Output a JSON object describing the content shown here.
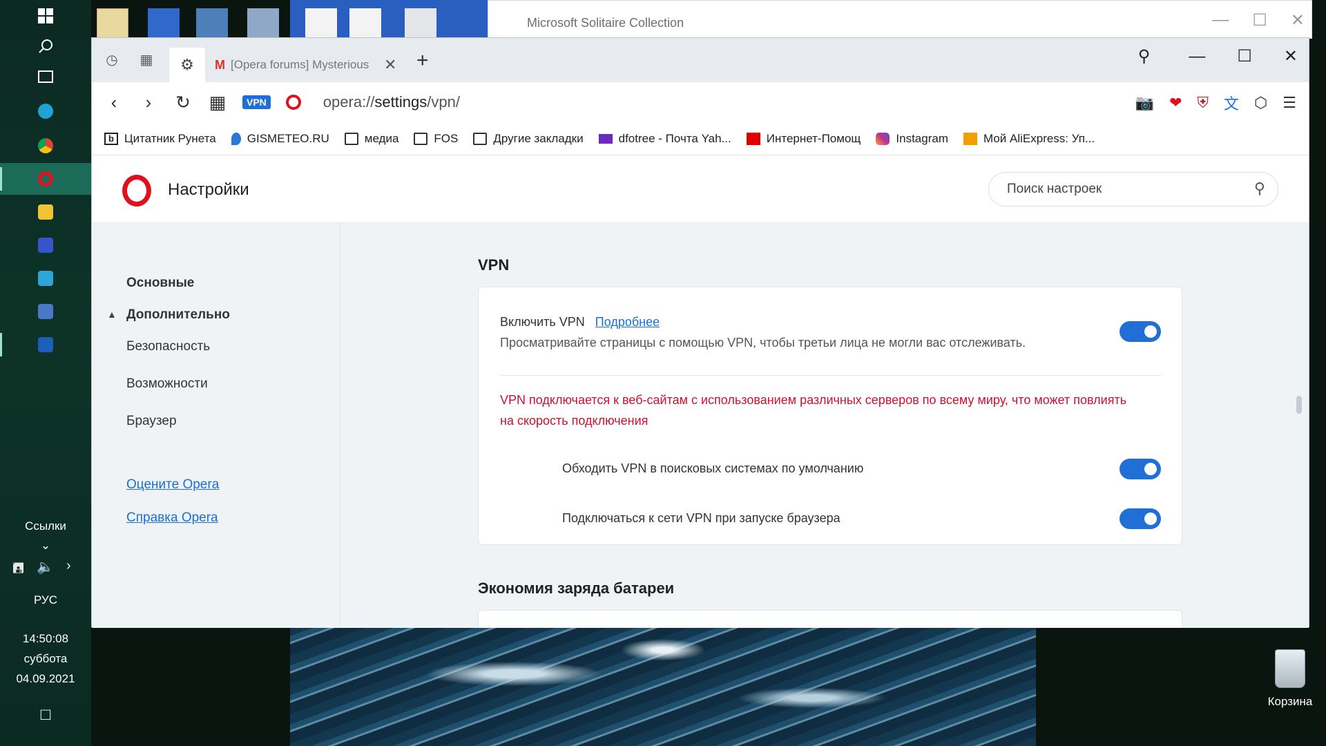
{
  "taskbar": {
    "links_label": "Ссылки",
    "links_chevron": "⌄",
    "language": "РУС",
    "time": "14:50:08",
    "weekday": "суббота",
    "date": "04.09.2021",
    "icons": [
      "windows-logo-icon",
      "search-icon",
      "task-view-icon",
      "edge-icon",
      "chrome-icon",
      "opera-icon",
      "file-explorer-icon",
      "save-icon",
      "store-icon",
      "remote-icon",
      "solitaire-icon"
    ]
  },
  "solitaire": {
    "title": "Microsoft Solitaire Collection"
  },
  "browser": {
    "tab_title": "[Opera forums] Mysterious",
    "url_scheme": "opera://",
    "url_host": "settings",
    "url_path": "/vpn/",
    "vpn_badge": "VPN",
    "bookmarks": [
      {
        "label": "Цитатник Рунета",
        "icon": "bookmark-b-icon",
        "color": "#222222"
      },
      {
        "label": "GISMETEO.RU",
        "icon": "gismeteo-icon",
        "color": "#2a7ad5"
      },
      {
        "label": "медиа",
        "icon": "folder-icon",
        "color": "#333333"
      },
      {
        "label": "FOS",
        "icon": "folder-icon",
        "color": "#333333"
      },
      {
        "label": "Другие закладки",
        "icon": "folder-icon",
        "color": "#333333"
      },
      {
        "label": "dfotree - Почта Yah...",
        "icon": "yahoo-mail-icon",
        "color": "#6b2bbd"
      },
      {
        "label": "Интернет-Помощ",
        "icon": "mts-icon",
        "color": "#e00000"
      },
      {
        "label": "Instagram",
        "icon": "instagram-icon",
        "color": "#c13584"
      },
      {
        "label": "Мой AliExpress: Уп...",
        "icon": "aliexpress-icon",
        "color": "#f2a000"
      }
    ],
    "bookmarks_more": "»"
  },
  "settings": {
    "title": "Настройки",
    "search_placeholder": "Поиск настроек",
    "nav": {
      "basic": "Основные",
      "advanced": "Дополнительно",
      "security": "Безопасность",
      "features": "Возможности",
      "browser": "Браузер",
      "rate": "Оцените Opera",
      "help": "Справка Opera"
    },
    "vpn": {
      "heading": "VPN",
      "enable_label": "Включить VPN",
      "learn_more": "Подробнее",
      "enable_desc": "Просматривайте страницы с помощью VPN, чтобы третьи лица не могли вас отслеживать.",
      "warning": "VPN подключается к веб-сайтам с использованием различных серверов по всему миру, что может повлиять на скорость подключения",
      "bypass_label": "Обходить VPN в поисковых системах по умолчанию",
      "connect_label": "Подключаться к сети VPN при запуске браузера",
      "enable_on": true,
      "bypass_on": true,
      "connect_on": true
    },
    "battery": {
      "heading": "Экономия заряда батареи"
    }
  },
  "desktop": {
    "recycle_bin": "Корзина"
  },
  "colors": {
    "accent": "#1f6fd6",
    "warning": "#d0102e",
    "opera_red": "#e0101f"
  }
}
